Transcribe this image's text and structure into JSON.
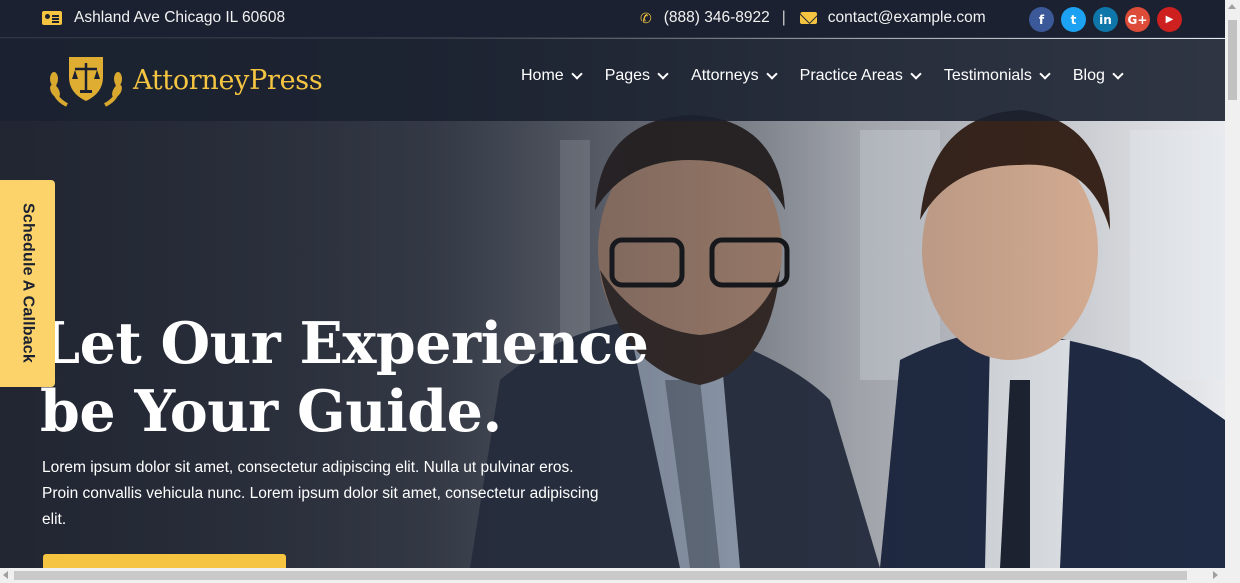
{
  "topbar": {
    "address": "Ashland Ave Chicago IL 60608",
    "phone": "(888) 346-8922",
    "separator": "|",
    "email": "contact@example.com",
    "social": [
      {
        "name": "facebook",
        "glyph": "f",
        "color": "#3b5998"
      },
      {
        "name": "twitter",
        "glyph": "t",
        "color": "#1da1f2"
      },
      {
        "name": "linkedin",
        "glyph": "in",
        "color": "#0e76a8"
      },
      {
        "name": "google-plus",
        "glyph": "G+",
        "color": "#dd4b39"
      },
      {
        "name": "youtube",
        "glyph": "▶",
        "color": "#cd201f"
      }
    ]
  },
  "header": {
    "logo_text": "AttorneyPress",
    "nav": [
      {
        "label": "Home"
      },
      {
        "label": "Pages"
      },
      {
        "label": "Attorneys"
      },
      {
        "label": "Practice Areas"
      },
      {
        "label": "Testimonials"
      },
      {
        "label": "Blog"
      }
    ]
  },
  "hero": {
    "title_line1": "Let Our Experience",
    "title_line2": "be Your Guide.",
    "text": "Lorem ipsum dolor sit amet, consectetur adipiscing elit. Nulla ut pulvinar eros. Proin convallis vehicula nunc. Lorem ipsum dolor sit amet, consectetur adipiscing elit."
  },
  "callback_tab": "Schedule A Callback",
  "colors": {
    "accent": "#f5c542",
    "topbar_bg": "#1b2130"
  }
}
